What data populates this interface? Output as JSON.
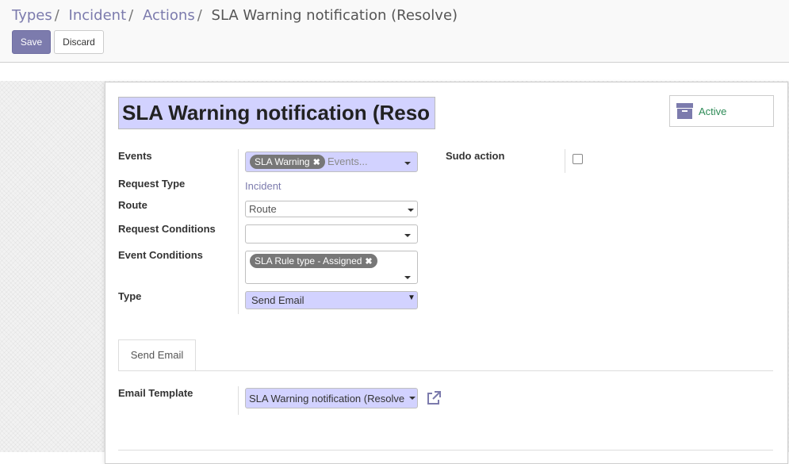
{
  "breadcrumb": {
    "items": [
      "Types",
      "Incident",
      "Actions"
    ],
    "separator": "/",
    "current": "SLA Warning notification (Resolve)"
  },
  "toolbar": {
    "save_label": "Save",
    "discard_label": "Discard"
  },
  "form": {
    "title": "SLA Warning notification (Reso",
    "active_label": "Active",
    "events": {
      "label": "Events",
      "tags": [
        "SLA Warning"
      ],
      "placeholder": "Events..."
    },
    "sudo": {
      "label": "Sudo action",
      "checked": false
    },
    "request_type": {
      "label": "Request Type",
      "value": "Incident"
    },
    "route": {
      "label": "Route",
      "placeholder": "Route"
    },
    "request_conditions": {
      "label": "Request Conditions",
      "value": ""
    },
    "event_conditions": {
      "label": "Event Conditions",
      "tags": [
        "SLA Rule type - Assigned"
      ]
    },
    "type": {
      "label": "Type",
      "value": "Send Email"
    },
    "tabs": [
      {
        "label": "Send Email",
        "active": true
      }
    ],
    "email_template": {
      "label": "Email Template",
      "value": "SLA Warning notification (Resolve"
    }
  },
  "icons": {
    "active": "archive-box-icon",
    "external": "external-link-icon",
    "tag_remove": "close-icon"
  },
  "colors": {
    "accent": "#7c7bad",
    "required_bg": "#d2d2ff",
    "active_text": "#2e8b57",
    "tag_bg": "#777777"
  }
}
